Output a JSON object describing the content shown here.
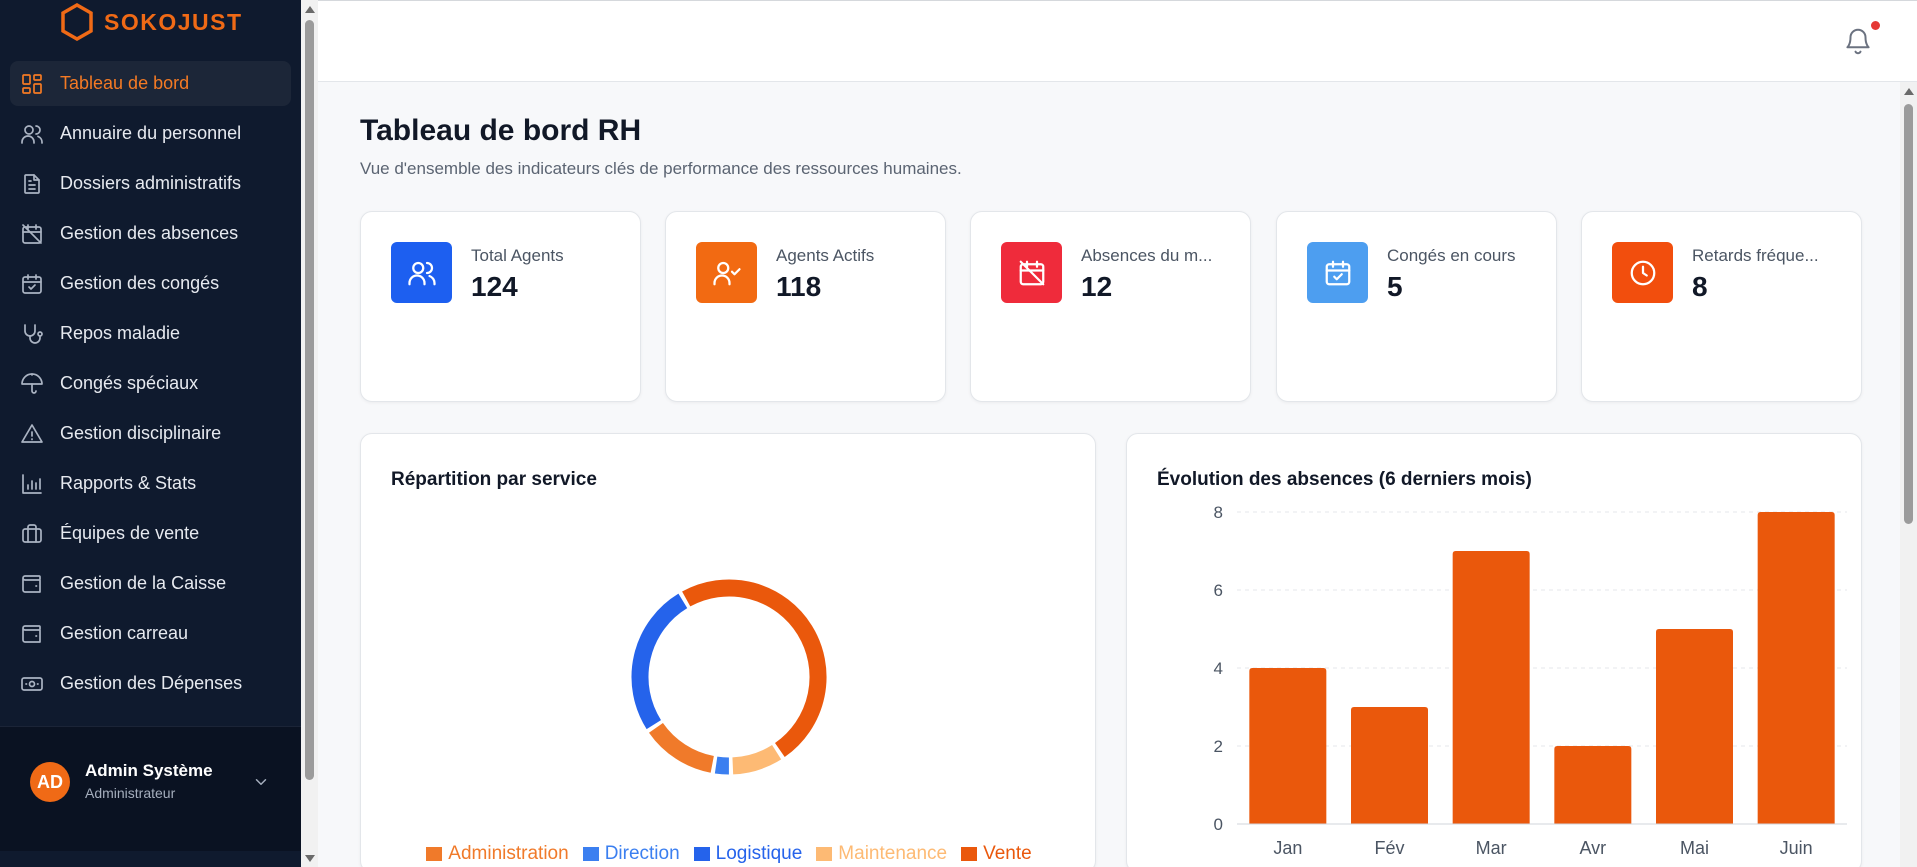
{
  "brand": {
    "name": "SOKOJUST",
    "color": "#f06a16"
  },
  "sidebar": {
    "items": [
      {
        "label": "Tableau de bord",
        "icon": "dashboard-icon",
        "active": true
      },
      {
        "label": "Annuaire du personnel",
        "icon": "users-icon"
      },
      {
        "label": "Dossiers administratifs",
        "icon": "file-icon"
      },
      {
        "label": "Gestion des absences",
        "icon": "calendar-off-icon"
      },
      {
        "label": "Gestion des congés",
        "icon": "calendar-check-icon"
      },
      {
        "label": "Repos maladie",
        "icon": "stethoscope-icon"
      },
      {
        "label": "Congés spéciaux",
        "icon": "umbrella-icon"
      },
      {
        "label": "Gestion disciplinaire",
        "icon": "warning-icon"
      },
      {
        "label": "Rapports & Stats",
        "icon": "bar-chart-icon"
      },
      {
        "label": "Équipes de vente",
        "icon": "briefcase-icon"
      },
      {
        "label": "Gestion de la Caisse",
        "icon": "wallet-icon"
      },
      {
        "label": "Gestion carreau",
        "icon": "wallet-icon"
      },
      {
        "label": "Gestion des Dépenses",
        "icon": "banknote-icon"
      }
    ],
    "user": {
      "initials": "AD",
      "name": "Admin Système",
      "role": "Administrateur"
    }
  },
  "header": {
    "notification_dot": true
  },
  "main": {
    "title": "Tableau de bord RH",
    "subtitle": "Vue d'ensemble des indicateurs clés de performance des ressources humaines."
  },
  "kpis": [
    {
      "label": "Total Agents",
      "value": "124",
      "icon": "users-icon",
      "color": "#1d5ff0"
    },
    {
      "label": "Agents Actifs",
      "value": "118",
      "icon": "user-check-icon",
      "color": "#f26a12"
    },
    {
      "label": "Absences du m...",
      "value": "12",
      "icon": "calendar-off-icon",
      "color": "#ef2b3b"
    },
    {
      "label": "Congés en cours",
      "value": "5",
      "icon": "calendar-check-icon",
      "color": "#4d9ef0"
    },
    {
      "label": "Retards fréque...",
      "value": "8",
      "icon": "clock-icon",
      "color": "#f24e0d"
    }
  ],
  "charts": {
    "donut_title": "Répartition par service",
    "bar_title": "Évolution des absences (6 derniers mois)"
  },
  "chart_data": [
    {
      "type": "pie",
      "title": "Répartition par service",
      "categories": [
        "Administration",
        "Direction",
        "Logistique",
        "Maintenance",
        "Vente"
      ],
      "values": [
        13,
        3,
        26,
        9,
        49
      ],
      "colors": [
        "#f07a2a",
        "#3b7ff0",
        "#2563eb",
        "#fdba74",
        "#ea580c"
      ],
      "legend": "bottom"
    },
    {
      "type": "bar",
      "title": "Évolution des absences (6 derniers mois)",
      "categories": [
        "Jan",
        "Fév",
        "Mar",
        "Avr",
        "Mai",
        "Juin"
      ],
      "values": [
        4,
        3,
        7,
        2,
        5,
        8
      ],
      "yticks": [
        0,
        2,
        4,
        6,
        8
      ],
      "ylim": [
        0,
        8
      ],
      "grid": true,
      "color": "#ea580c"
    }
  ]
}
